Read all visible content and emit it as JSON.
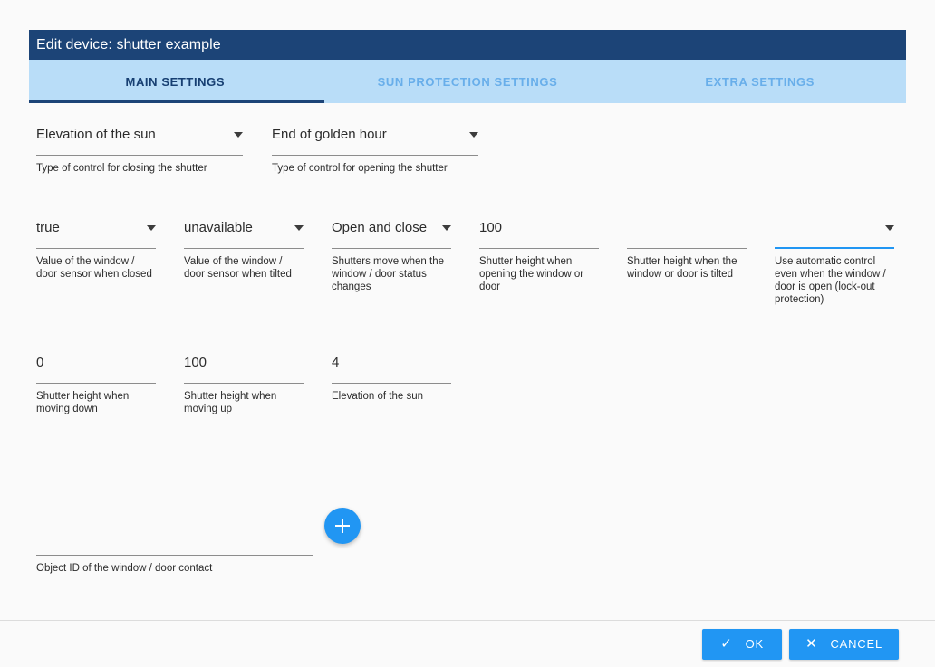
{
  "dialog": {
    "title": "Edit device: shutter example"
  },
  "tabs": [
    {
      "label": "MAIN SETTINGS",
      "active": true
    },
    {
      "label": "SUN PROTECTION SETTINGS",
      "active": false
    },
    {
      "label": "EXTRA SETTINGS",
      "active": false
    }
  ],
  "fields": {
    "row1": [
      {
        "value": "Elevation of the sun",
        "hint": "Type of control for closing the shutter",
        "type": "select",
        "focused": false
      },
      {
        "value": "End of golden hour",
        "hint": "Type of control for opening the shutter",
        "type": "select",
        "focused": false
      }
    ],
    "row2": [
      {
        "value": "true",
        "hint": "Value of the window / door sensor when closed",
        "type": "select",
        "focused": false
      },
      {
        "value": "unavailable",
        "hint": "Value of the window / door sensor when tilted",
        "type": "select",
        "focused": false
      },
      {
        "value": "Open and close",
        "hint": "Shutters move when the window / door status changes",
        "type": "select",
        "focused": false
      },
      {
        "value": "100",
        "hint": "Shutter height when opening the window or door",
        "type": "text",
        "focused": false
      },
      {
        "value": "",
        "hint": "Shutter height when the window or door is tilted",
        "type": "text",
        "focused": false
      },
      {
        "value": "",
        "hint": "Use automatic control even when the window / door is open (lock-out protection)",
        "type": "select",
        "focused": true
      }
    ],
    "row3": [
      {
        "value": "0",
        "hint": "Shutter height when moving down",
        "type": "text",
        "focused": false
      },
      {
        "value": "100",
        "hint": "Shutter height when moving up",
        "type": "text",
        "focused": false
      },
      {
        "value": "4",
        "hint": "Elevation of the sun",
        "type": "text",
        "focused": false
      }
    ],
    "object_id": {
      "value": "",
      "hint": "Object ID of the window / door contact",
      "type": "text",
      "focused": false
    }
  },
  "add_button": {
    "icon": "plus-icon"
  },
  "footer": {
    "ok_label": "OK",
    "ok_glyph": "✓",
    "cancel_label": "CANCEL",
    "cancel_glyph": "✕"
  },
  "colors": {
    "header_bg": "#1c4477",
    "tabbar_bg": "#b9ddf8",
    "tab_active": "#173f72",
    "tab_inactive": "#68aeea",
    "accent": "#2196f3",
    "page_bg": "#fafafa"
  }
}
